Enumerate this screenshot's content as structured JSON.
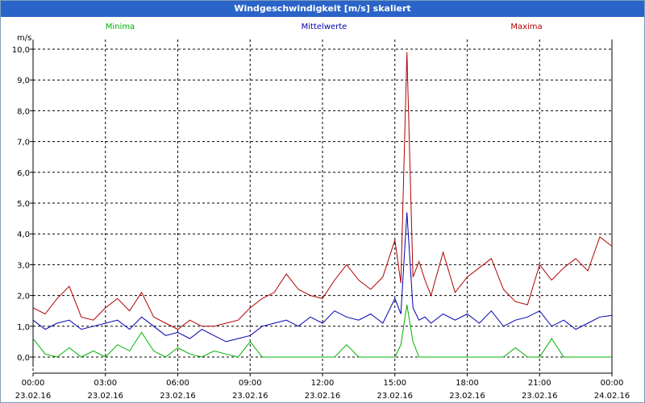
{
  "window": {
    "title": "Windgeschwindigkeit [m/s] skaliert"
  },
  "chart_data": {
    "type": "line",
    "title": "Windgeschwindigkeit [m/s] skaliert",
    "ylabel": "m/s",
    "xlabel": "",
    "ylim": [
      0,
      10
    ],
    "xlim": [
      "23.02.16 00:00",
      "24.02.16 00:00"
    ],
    "grid": true,
    "yticks": [
      "0,0",
      "1,0",
      "2,0",
      "3,0",
      "4,0",
      "5,0",
      "6,0",
      "7,0",
      "8,0",
      "9,0",
      "10,0"
    ],
    "xticks": [
      {
        "time": "00:00",
        "date": "23.02.16"
      },
      {
        "time": "03:00",
        "date": "23.02.16"
      },
      {
        "time": "06:00",
        "date": "23.02.16"
      },
      {
        "time": "09:00",
        "date": "23.02.16"
      },
      {
        "time": "12:00",
        "date": "23.02.16"
      },
      {
        "time": "15:00",
        "date": "23.02.16"
      },
      {
        "time": "18:00",
        "date": "23.02.16"
      },
      {
        "time": "21:00",
        "date": "23.02.16"
      },
      {
        "time": "00:00",
        "date": "24.02.16"
      }
    ],
    "x_hours": [
      0,
      0.5,
      1,
      1.5,
      2,
      2.5,
      3,
      3.5,
      4,
      4.5,
      5,
      5.5,
      6,
      6.5,
      7,
      7.5,
      8,
      8.5,
      9,
      9.5,
      10,
      10.5,
      11,
      11.5,
      12,
      12.5,
      13,
      13.5,
      14,
      14.5,
      15,
      15.25,
      15.5,
      15.75,
      16,
      16.25,
      16.5,
      17,
      17.5,
      18,
      18.5,
      19,
      19.5,
      20,
      20.5,
      21,
      21.5,
      22,
      22.5,
      23,
      23.5,
      24
    ],
    "series": [
      {
        "name": "Minima",
        "color": "#00b000",
        "values": [
          0.6,
          0.1,
          0,
          0.3,
          0,
          0.2,
          0,
          0.4,
          0.2,
          0.8,
          0.2,
          0,
          0.3,
          0.1,
          0,
          0.2,
          0.1,
          0,
          0.5,
          0,
          0,
          0,
          0,
          0,
          0,
          0,
          0.4,
          0,
          0,
          0,
          0,
          0.4,
          1.7,
          0.5,
          0,
          0,
          0,
          0,
          0,
          0,
          0,
          0,
          0,
          0.3,
          0,
          0,
          0.6,
          0,
          0,
          0,
          0,
          0
        ]
      },
      {
        "name": "Mittelwerte",
        "color": "#0000b0",
        "values": [
          1.2,
          0.9,
          1.1,
          1.2,
          0.9,
          1.0,
          1.1,
          1.2,
          0.9,
          1.3,
          1.0,
          0.7,
          0.8,
          0.6,
          0.9,
          0.7,
          0.5,
          0.6,
          0.7,
          1.0,
          1.1,
          1.2,
          1.0,
          1.3,
          1.1,
          1.5,
          1.3,
          1.2,
          1.4,
          1.1,
          1.9,
          1.4,
          4.7,
          1.6,
          1.2,
          1.3,
          1.1,
          1.4,
          1.2,
          1.4,
          1.1,
          1.5,
          1.0,
          1.2,
          1.3,
          1.5,
          1.0,
          1.2,
          0.9,
          1.1,
          1.3,
          1.35
        ]
      },
      {
        "name": "Maxima",
        "color": "#b00000",
        "values": [
          1.6,
          1.4,
          1.9,
          2.3,
          1.3,
          1.2,
          1.6,
          1.9,
          1.5,
          2.1,
          1.3,
          1.1,
          0.9,
          1.2,
          1.0,
          1.0,
          1.1,
          1.2,
          1.6,
          1.9,
          2.1,
          2.7,
          2.2,
          2.0,
          1.9,
          2.5,
          3.0,
          2.5,
          2.2,
          2.6,
          3.8,
          2.4,
          9.9,
          2.6,
          3.1,
          2.5,
          2.0,
          3.4,
          2.1,
          2.6,
          2.9,
          3.2,
          2.2,
          1.8,
          1.7,
          3.0,
          2.5,
          2.9,
          3.2,
          2.8,
          3.9,
          3.6
        ]
      }
    ],
    "legend": "top"
  }
}
